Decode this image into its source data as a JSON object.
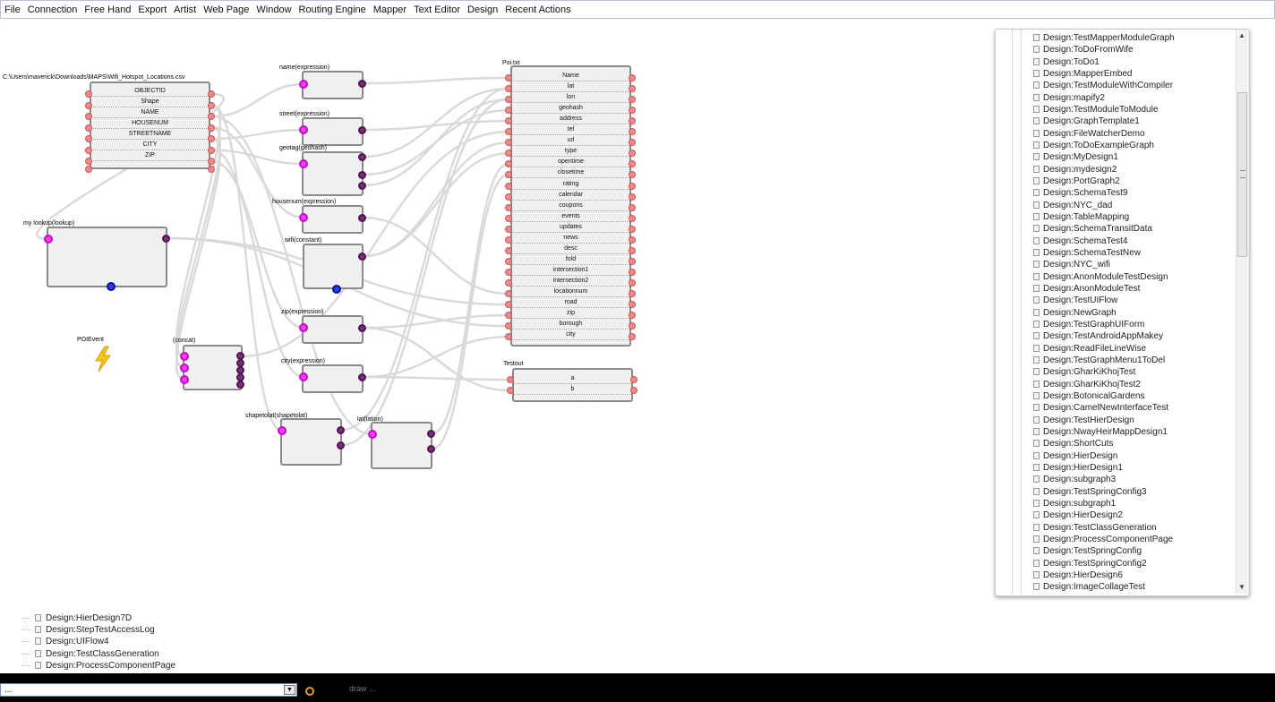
{
  "menu": [
    "File",
    "Connection",
    "Free Hand",
    "Export",
    "Artist",
    "Web Page",
    "Window",
    "Routing Engine",
    "Mapper",
    "Text Editor",
    "Design",
    "Recent Actions"
  ],
  "graph": {
    "csv_source": {
      "title": "C:\\Users\\maverick\\Downloads\\MAPS\\Wifi_Hotspot_Locations.csv",
      "fields": [
        "OBJECTID",
        "Shape",
        "NAME",
        "HOUSENUM",
        "STREETNAME",
        "CITY",
        "ZIP"
      ]
    },
    "name_expr": {
      "title": "name(expression)"
    },
    "street_expr": {
      "title": "street(expression)"
    },
    "geotag": {
      "title": "geotag(geohash)"
    },
    "housenum_expr": {
      "title": "housenum(expression)"
    },
    "wifi_const": {
      "title": "wifi(constant)"
    },
    "zip_expr": {
      "title": "zip(expression)"
    },
    "city_expr": {
      "title": "city(expression)"
    },
    "lookup": {
      "title": "my lookup(lookup)"
    },
    "poi_event": {
      "title": "POIEvent"
    },
    "concat": {
      "title": "(concat)"
    },
    "shape_to_lat": {
      "title": "shapetolat(shapetolat)"
    },
    "lat_node": {
      "title": "lat(lation)"
    },
    "poi_txt": {
      "title": "Poi.txt",
      "fields": [
        "Name",
        "lat",
        "lon",
        "geohash",
        "address",
        "tel",
        "url",
        "type",
        "opentime",
        "closetime",
        "rating",
        "calendar",
        "coupons",
        "events",
        "updates",
        "news",
        "desc",
        "fold",
        "intersection1",
        "intersection2",
        "locationnum",
        "road",
        "zip",
        "borough",
        "city"
      ]
    },
    "testout": {
      "title": "Testout",
      "fields": [
        "a",
        "b"
      ]
    }
  },
  "design_tree": {
    "items": [
      "Design:TestMapperModuleGraph",
      "Design:ToDoFromWife",
      "Design:ToDo1",
      "Design:MapperEmbed",
      "Design:TestModuleWithCompiler",
      "Design:mapify2",
      "Design:TestModuleToModule",
      "Design:GraphTemplate1",
      "Design:FileWatcherDemo",
      "Design:ToDoExampleGraph",
      "Design:MyDesign1",
      "Design:mydesign2",
      "Design:PortGraph2",
      "Design:SchemaTest9",
      "Design:NYC_dad",
      "Design:TableMapping",
      "Design:SchemaTransitData",
      "Design:SchemaTest4",
      "Design:SchemaTestNew",
      "Design:NYC_wifi",
      "Design:AnonModuleTestDesign",
      "Design:AnonModuleTest",
      "Design:TestUIFlow",
      "Design:NewGraph",
      "Design:TestGraphUIForm",
      "Design:TestAndroidAppMakey",
      "Design:ReadFileLineWise",
      "Design:TestGraphMenu1ToDel",
      "Design:GharKiKhojTest",
      "Design:GharKiKhojTest2",
      "Design:BotonicalGardens",
      "Design:CamelNewInterfaceTest",
      "Design:TestHierDesign",
      "Design:NwayHeirMappDesign1",
      "Design:ShortCuts",
      "Design:HierDesign",
      "Design:HierDesign1",
      "Design:subgraph3",
      "Design:TestSpringConfig3",
      "Design:subgraph1",
      "Design:HierDesign2",
      "Design:TestClassGeneration",
      "Design:ProcessComponentPage",
      "Design:TestSpringConfig",
      "Design:TestSpringConfig2",
      "Design:HierDesign6",
      "Design:ImageCollageTest"
    ]
  },
  "recent_designs": [
    "Design:HierDesign7D",
    "Design:StepTestAccessLog",
    "Design:UIFlow4",
    "Design:TestClassGeneration",
    "Design:ProcessComponentPage"
  ],
  "bottom": {
    "select_value": "...",
    "status_text": "draw ..."
  },
  "colors": {
    "input_port": "#ff3bff",
    "output_port": "#7a2f7a",
    "boundary_port": "#f08a8a",
    "event_port": "#2a3cff",
    "event_icon": "#f5c518"
  },
  "icons": {
    "event": "lightning-bolt-icon",
    "dropdown": "chevron-down-icon",
    "tree_node": "document-icon"
  }
}
